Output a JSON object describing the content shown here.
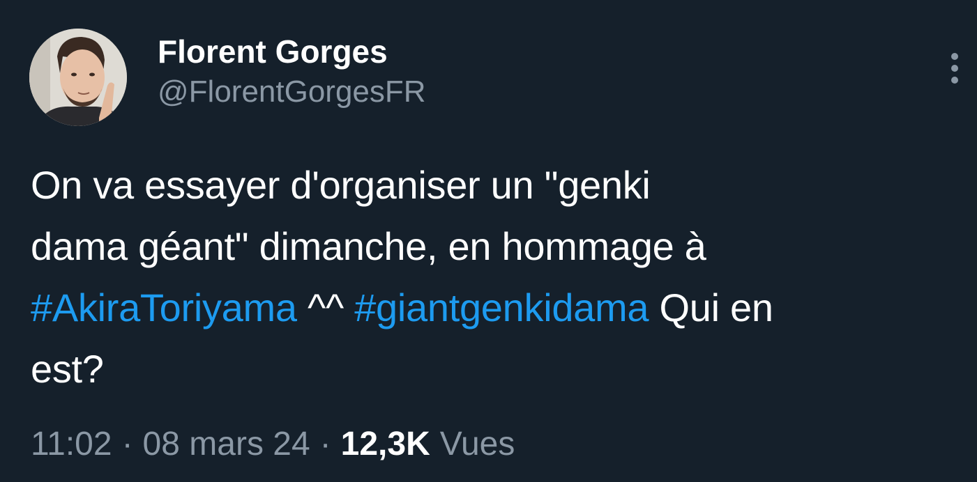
{
  "author": {
    "display_name": "Florent Gorges",
    "handle": "@FlorentGorgesFR"
  },
  "tweet": {
    "line1": "On va essayer d'organiser un \"genki",
    "line2": "dama géant\" dimanche, en hommage à",
    "hashtag1": "#AkiraToriyama",
    "middle_text": " ^^ ",
    "hashtag2": "#giantgenkidama",
    "line3_tail": " Qui en",
    "line4": "est?"
  },
  "meta": {
    "time": "11:02",
    "separator": "·",
    "date": "08 mars 24",
    "views_count": "12,3K",
    "views_label": "Vues"
  },
  "colors": {
    "background": "#15202b",
    "text": "#ffffff",
    "secondary": "#8b98a5",
    "link": "#1d9bf0"
  },
  "icons": {
    "more": "more-vertical-icon"
  }
}
